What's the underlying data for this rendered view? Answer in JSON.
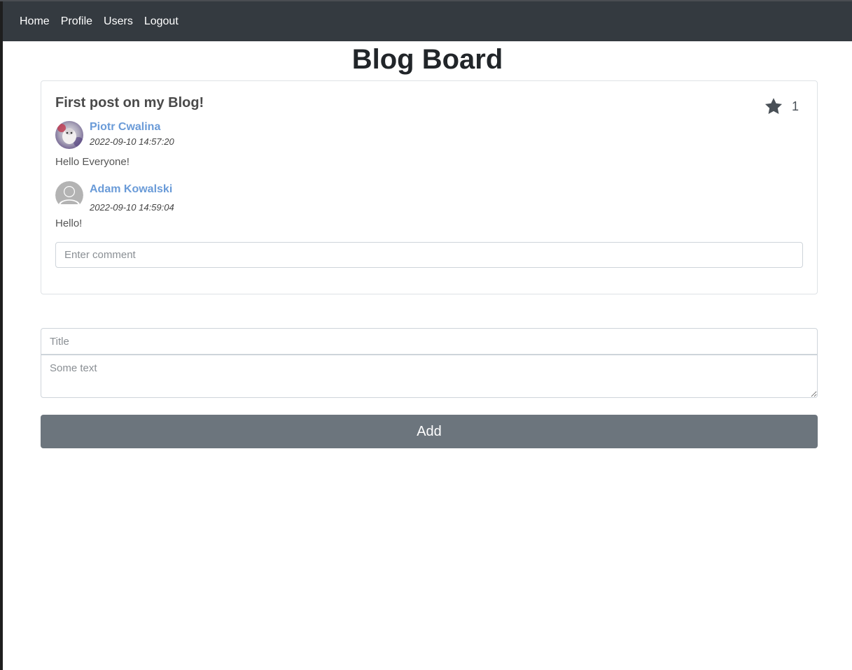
{
  "nav": {
    "items": [
      "Home",
      "Profile",
      "Users",
      "Logout"
    ]
  },
  "page": {
    "title": "Blog Board"
  },
  "post": {
    "title": "First post on my Blog!",
    "stars": "1",
    "author": "Piotr Cwalina",
    "timestamp": "2022-09-10 14:57:20",
    "body": "Hello Everyone!",
    "comments": [
      {
        "author": "Adam Kowalski",
        "timestamp": "2022-09-10 14:59:04",
        "body": "Hello!"
      }
    ],
    "comment_placeholder": "Enter comment"
  },
  "new_post": {
    "title_placeholder": "Title",
    "text_placeholder": "Some text",
    "add_label": "Add"
  },
  "colors": {
    "navbar": "#343a40",
    "author_link": "#6a9bd8",
    "add_button": "#6c757d"
  },
  "icons": {
    "star": "star-icon",
    "author_avatar": "user-photo-avatar",
    "comment_avatar": "default-user-icon"
  }
}
